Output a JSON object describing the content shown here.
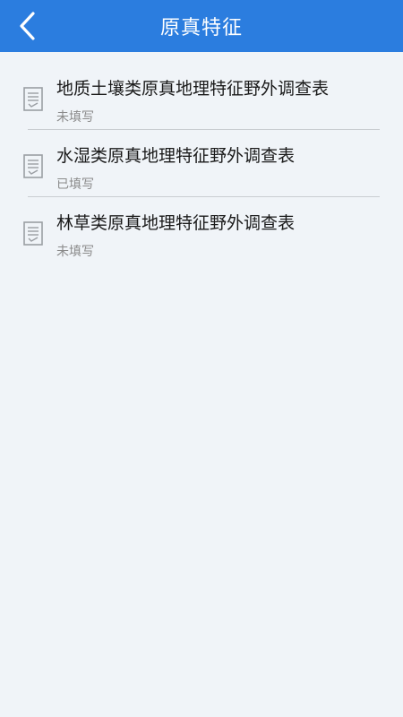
{
  "header": {
    "title": "原真特征",
    "back_icon": "chevron-left-icon"
  },
  "items": [
    {
      "title": "地质土壤类原真地理特征野外调查表",
      "status": "未填写",
      "icon": "form-document-icon"
    },
    {
      "title": "水湿类原真地理特征野外调查表",
      "status": "已填写",
      "icon": "form-document-icon"
    },
    {
      "title": "林草类原真地理特征野外调查表",
      "status": "未填写",
      "icon": "form-document-icon"
    }
  ],
  "colors": {
    "header_bg": "#2b7ddf",
    "page_bg": "#f0f4f8",
    "title_text": "#1a1a1a",
    "status_text": "#8a8a8a"
  }
}
